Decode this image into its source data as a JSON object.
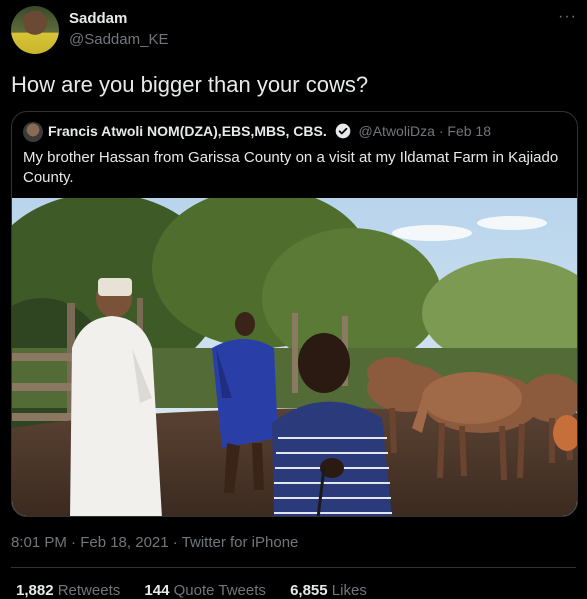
{
  "tweet": {
    "author_name": "Saddam",
    "author_handle": "@Saddam_KE",
    "more_label": "···",
    "text": "How are you bigger than your cows?",
    "timestamp": "8:01 PM · Feb 18, 2021 · Twitter for iPhone"
  },
  "quoted": {
    "author_name": "Francis Atwoli NOM(DZA),EBS,MBS, CBS.",
    "author_handle": "@AtwoliDza",
    "separator": "·",
    "date": "Feb 18",
    "text": "My brother Hassan from Garissa County on a visit at my Ildamat Farm in Kajiado County.",
    "verified": true
  },
  "stats": {
    "retweets_count": "1,882",
    "retweets_label": "Retweets",
    "quotes_count": "144",
    "quotes_label": "Quote Tweets",
    "likes_count": "6,855",
    "likes_label": "Likes"
  },
  "colors": {
    "background": "#000000",
    "text": "#e7e9ea",
    "muted": "#71767b",
    "border": "#2f3336"
  }
}
